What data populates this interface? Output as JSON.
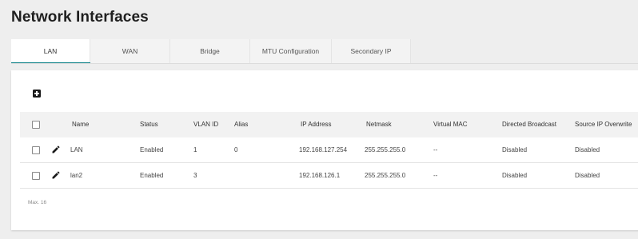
{
  "page": {
    "title": "Network Interfaces"
  },
  "tabs": [
    {
      "label": "LAN",
      "active": true
    },
    {
      "label": "WAN",
      "active": false
    },
    {
      "label": "Bridge",
      "active": false
    },
    {
      "label": "MTU Configuration",
      "active": false
    },
    {
      "label": "Secondary IP",
      "active": false
    }
  ],
  "toolbar": {
    "add_icon": "add-box-icon"
  },
  "table": {
    "headers": {
      "name": "Name",
      "status": "Status",
      "vlan_id": "VLAN ID",
      "alias": "Alias",
      "ip_address": "IP Address",
      "netmask": "Netmask",
      "virtual_mac": "Virtual MAC",
      "directed_broadcast": "Directed Broadcast",
      "source_ip_overwrite": "Source IP Overwrite"
    },
    "rows": [
      {
        "name": "LAN",
        "status": "Enabled",
        "vlan_id": "1",
        "alias": "0",
        "ip_address": "192.168.127.254",
        "netmask": "255.255.255.0",
        "virtual_mac": "--",
        "directed_broadcast": "Disabled",
        "source_ip_overwrite": "Disabled"
      },
      {
        "name": "lan2",
        "status": "Enabled",
        "vlan_id": "3",
        "alias": "",
        "ip_address": "192.168.126.1",
        "netmask": "255.255.255.0",
        "virtual_mac": "--",
        "directed_broadcast": "Disabled",
        "source_ip_overwrite": "Disabled"
      }
    ],
    "footer": "Max. 16"
  },
  "colors": {
    "accent": "#0a7f86",
    "header_bg": "#f2f2f2",
    "page_bg": "#eeeeee"
  }
}
